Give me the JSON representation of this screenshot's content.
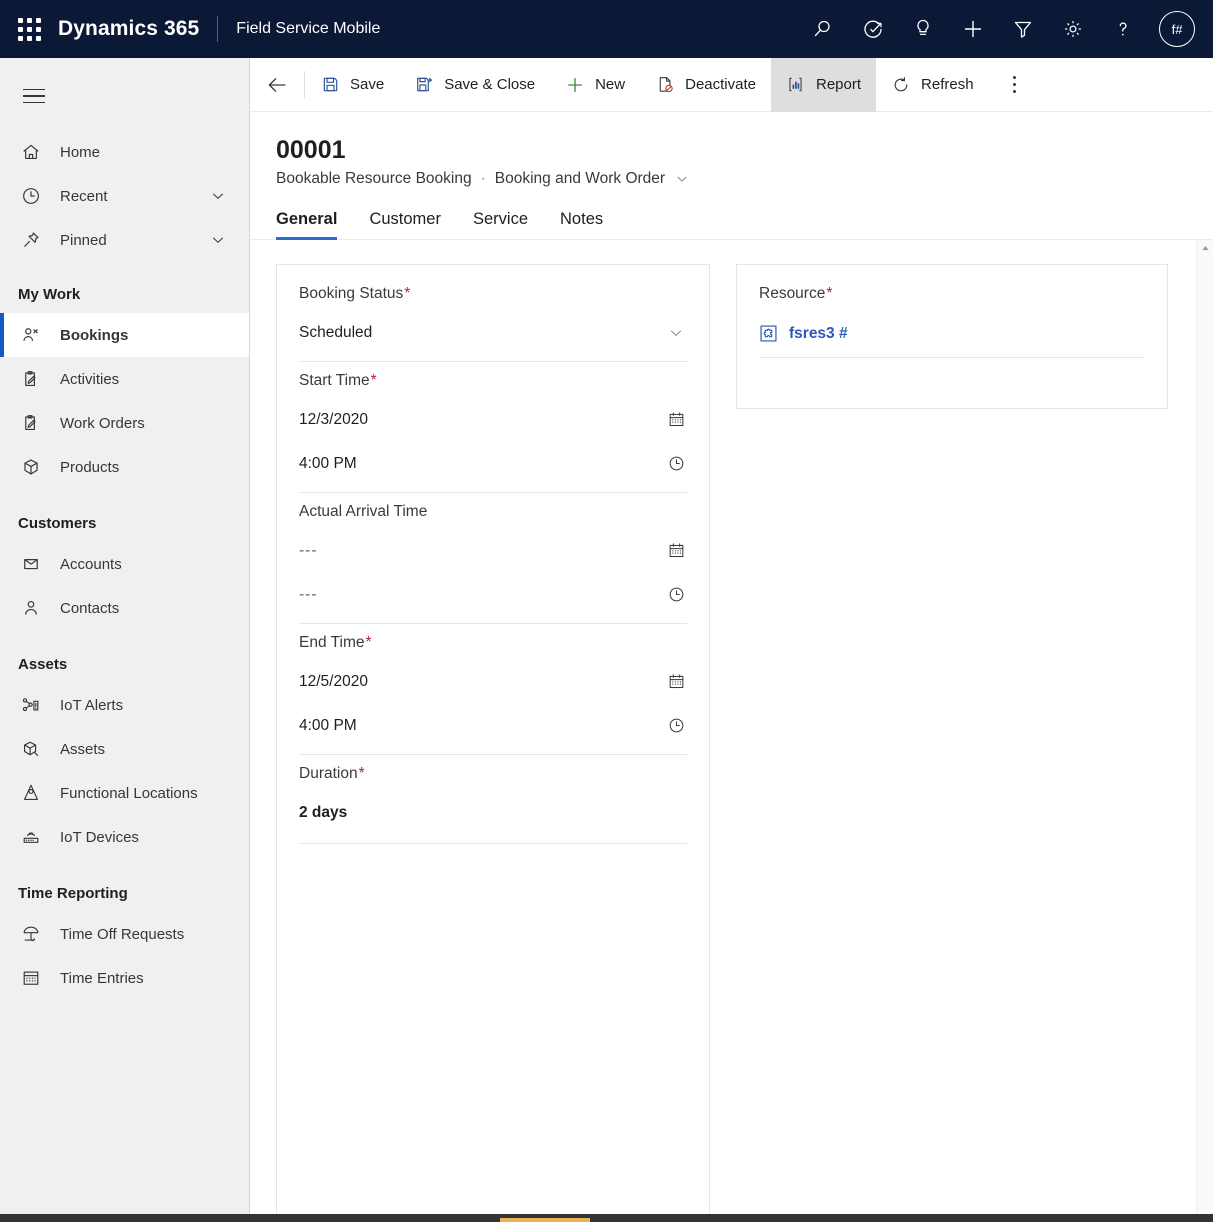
{
  "header": {
    "waffle_label": "app-launcher",
    "brand": "Dynamics 365",
    "app_name": "Field Service Mobile",
    "icons": [
      {
        "name": "search-icon",
        "label": "Search"
      },
      {
        "name": "assistant-icon",
        "label": "Assistant"
      },
      {
        "name": "lightbulb-icon",
        "label": "Insights"
      },
      {
        "name": "plus-icon",
        "label": "Quick Create"
      },
      {
        "name": "filter-icon",
        "label": "Filter"
      },
      {
        "name": "gear-icon",
        "label": "Settings"
      },
      {
        "name": "help-icon",
        "label": "Help"
      }
    ],
    "avatar_initials": "f#",
    "colors": {
      "bar": "#0b1836",
      "text": "#ffffff"
    }
  },
  "sidebar": {
    "top_items": [
      {
        "label": "Home",
        "icon": "home-icon",
        "chevron": false
      },
      {
        "label": "Recent",
        "icon": "clock-icon",
        "chevron": true
      },
      {
        "label": "Pinned",
        "icon": "pin-icon",
        "chevron": true
      }
    ],
    "groups": [
      {
        "title": "My Work",
        "items": [
          {
            "label": "Bookings",
            "icon": "bookings-icon",
            "selected": true
          },
          {
            "label": "Activities",
            "icon": "activities-icon",
            "selected": false
          },
          {
            "label": "Work Orders",
            "icon": "work-orders-icon",
            "selected": false
          },
          {
            "label": "Products",
            "icon": "products-icon",
            "selected": false
          }
        ]
      },
      {
        "title": "Customers",
        "items": [
          {
            "label": "Accounts",
            "icon": "accounts-icon",
            "selected": false
          },
          {
            "label": "Contacts",
            "icon": "contacts-icon",
            "selected": false
          }
        ]
      },
      {
        "title": "Assets",
        "items": [
          {
            "label": "IoT Alerts",
            "icon": "iot-alerts-icon",
            "selected": false
          },
          {
            "label": "Assets",
            "icon": "assets-icon",
            "selected": false
          },
          {
            "label": "Functional Locations",
            "icon": "functional-locations-icon",
            "selected": false
          },
          {
            "label": "IoT Devices",
            "icon": "iot-devices-icon",
            "selected": false
          }
        ]
      },
      {
        "title": "Time Reporting",
        "items": [
          {
            "label": "Time Off Requests",
            "icon": "time-off-icon",
            "selected": false
          },
          {
            "label": "Time Entries",
            "icon": "time-entries-icon",
            "selected": false
          }
        ]
      }
    ],
    "selected_accent": "#0f5bbf"
  },
  "commandbar": {
    "back": "back-arrow",
    "buttons": [
      {
        "label": "Save",
        "icon": "save-icon",
        "active": false
      },
      {
        "label": "Save & Close",
        "icon": "save-close-icon",
        "active": false
      },
      {
        "label": "New",
        "icon": "plus-icon",
        "active": false
      },
      {
        "label": "Deactivate",
        "icon": "deactivate-icon",
        "active": false
      },
      {
        "label": "Report",
        "icon": "report-icon",
        "active": true
      },
      {
        "label": "Refresh",
        "icon": "refresh-icon",
        "active": false
      }
    ],
    "overflow": "more-commands"
  },
  "record": {
    "title": "00001",
    "entity": "Bookable Resource Booking",
    "separator": "·",
    "form_name": "Booking and Work Order"
  },
  "tabs": [
    {
      "label": "General",
      "active": true
    },
    {
      "label": "Customer",
      "active": false
    },
    {
      "label": "Service",
      "active": false
    },
    {
      "label": "Notes",
      "active": false
    }
  ],
  "form": {
    "left_card": {
      "fields": [
        {
          "label": "Booking Status",
          "required": true,
          "type": "optionset",
          "value": "Scheduled",
          "icon": "chevron-down-icon"
        },
        {
          "label": "Start Time",
          "required": true,
          "type": "datetime",
          "date": "12/3/2020",
          "time": "4:00 PM",
          "date_icon": "calendar-icon",
          "time_icon": "clock-icon"
        },
        {
          "label": "Actual Arrival Time",
          "required": false,
          "type": "datetime",
          "date": "---",
          "time": "---",
          "date_icon": "calendar-icon",
          "time_icon": "clock-icon"
        },
        {
          "label": "End Time",
          "required": true,
          "type": "datetime",
          "date": "12/5/2020",
          "time": "4:00 PM",
          "date_icon": "calendar-icon",
          "time_icon": "clock-icon"
        },
        {
          "label": "Duration",
          "required": true,
          "type": "text",
          "value": "2 days"
        }
      ]
    },
    "right_card": {
      "label": "Resource",
      "required": true,
      "lookup_value": "fsres3 #",
      "lookup_icon": "resource-entity-icon",
      "lookup_color": "#2b58b8"
    },
    "required_marker": "*",
    "required_color": "#b81d3b"
  },
  "scrollbar": {
    "up_arrow": "scroll-up-icon"
  }
}
